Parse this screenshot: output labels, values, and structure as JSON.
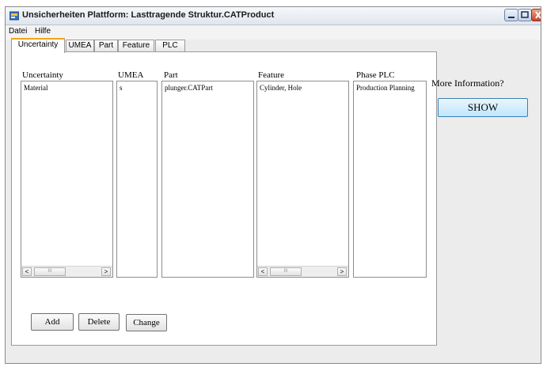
{
  "window": {
    "title": "Unsicherheiten Plattform: Lasttragende Struktur.CATProduct"
  },
  "menu": [
    "Datei",
    "Hilfe"
  ],
  "tabs": [
    {
      "label": "Uncertainty",
      "active": true
    },
    {
      "label": "UMEA",
      "active": false
    },
    {
      "label": "Part",
      "active": false
    },
    {
      "label": "Feature",
      "active": false
    },
    {
      "label": "PLC",
      "active": false
    }
  ],
  "columns": {
    "uncertainty": {
      "label": "Uncertainty",
      "items": [
        "Material"
      ]
    },
    "umea": {
      "label": "UMEA",
      "items": [
        "s"
      ]
    },
    "part": {
      "label": "Part",
      "items": [
        "plunger.CATPart"
      ]
    },
    "feature": {
      "label": "Feature",
      "items": [
        "Cylinder, Hole"
      ]
    },
    "phase": {
      "label": "Phase PLC",
      "items": [
        "Production Planning"
      ]
    }
  },
  "scrollbar": {
    "left_glyph": "<",
    "right_glyph": ">",
    "thumb_glyph": "III"
  },
  "buttons": {
    "add": "Add",
    "delete": "Delete",
    "change": "Change"
  },
  "more_info": {
    "label": "More Information?",
    "show_button": "SHOW"
  },
  "colors": {
    "active_tab_accent": "#f3a31b",
    "show_button_border": "#3c7fb1",
    "close_button": "#c2462c"
  }
}
